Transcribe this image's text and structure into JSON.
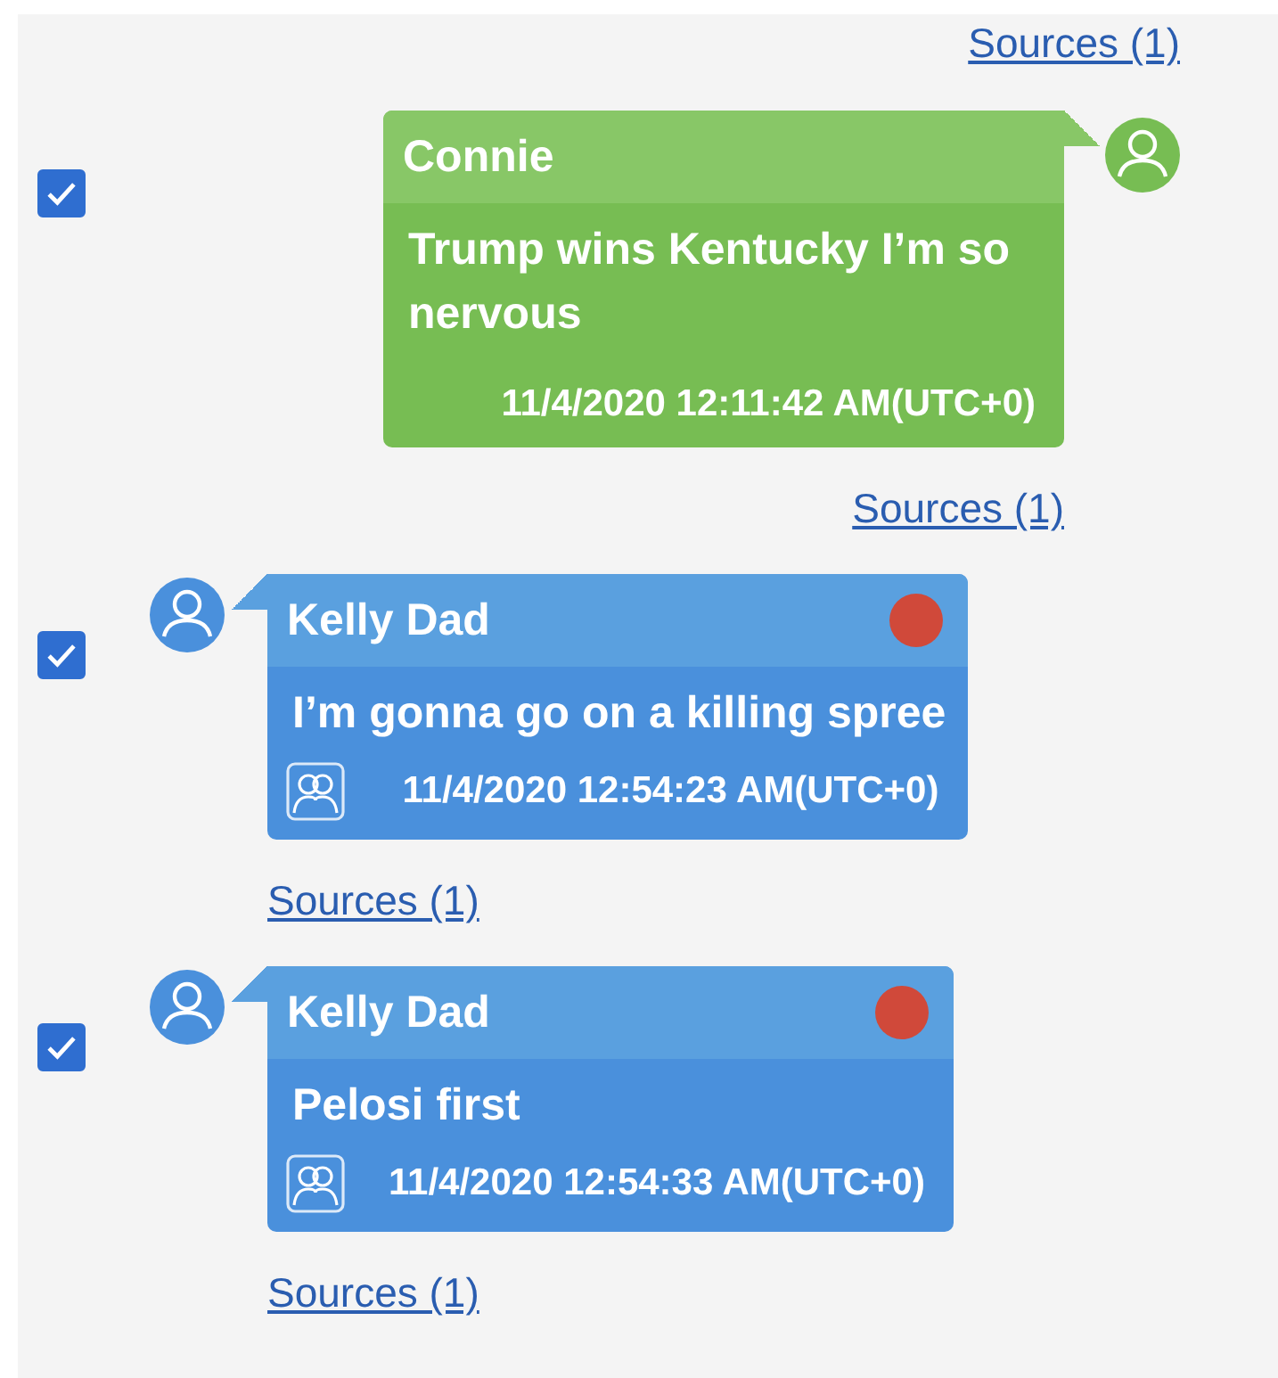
{
  "top_link": {
    "text": "Sources (1)"
  },
  "messages": [
    {
      "kind": "outgoing",
      "checked": true,
      "sender": "Connie",
      "flagged": false,
      "text": "Trump wins Kentucky I’m so nervous",
      "timestamp": "11/4/2020 12:11:42 AM(UTC+0)",
      "sources": "Sources (1)"
    },
    {
      "kind": "incoming",
      "checked": true,
      "sender": "Kelly Dad",
      "flagged": true,
      "text": "I’m gonna go on a killing spree",
      "timestamp": "11/4/2020 12:54:23 AM(UTC+0)",
      "sources": "Sources (1)"
    },
    {
      "kind": "incoming",
      "checked": true,
      "sender": "Kelly Dad",
      "flagged": true,
      "text": "Pelosi first",
      "timestamp": "11/4/2020 12:54:33 AM(UTC+0)",
      "sources": "Sources (1)"
    }
  ]
}
